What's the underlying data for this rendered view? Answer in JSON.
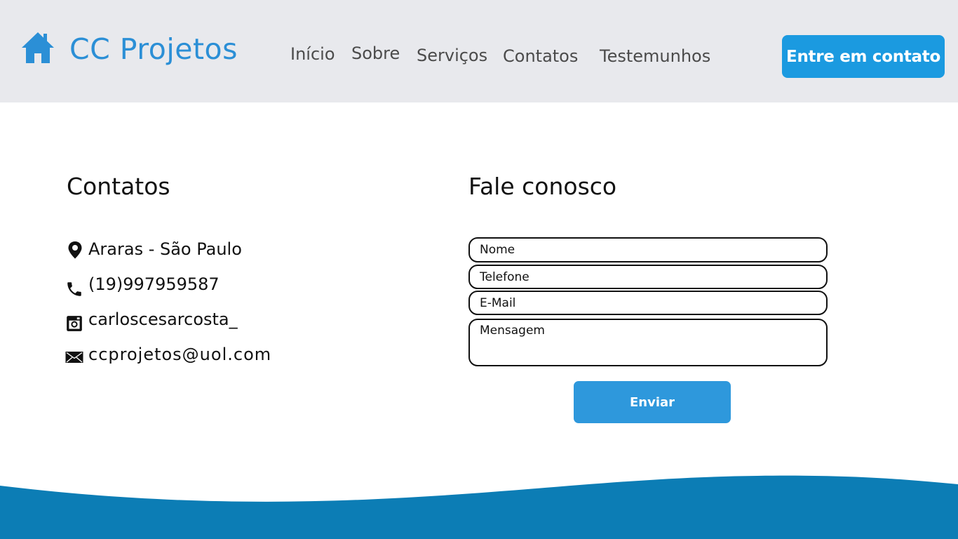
{
  "brand": {
    "name": "CC Projetos",
    "icon": "home-icon",
    "color": "#2b8fd6"
  },
  "nav": {
    "items": [
      {
        "label": "Início"
      },
      {
        "label": "Sobre"
      },
      {
        "label": "Serviços"
      },
      {
        "label": "Contatos"
      },
      {
        "label": "Testemunhos"
      }
    ],
    "cta_label": "Entre em contato"
  },
  "contacts": {
    "title": "Contatos",
    "items": [
      {
        "icon": "location-pin-icon",
        "text": "Araras - São Paulo"
      },
      {
        "icon": "phone-icon",
        "text": "(19)997959587"
      },
      {
        "icon": "instagram-icon",
        "text": "carloscesarcosta_"
      },
      {
        "icon": "envelope-icon",
        "text": "ccprojetos@uol.com"
      }
    ]
  },
  "form": {
    "title": "Fale conosco",
    "fields": {
      "name_placeholder": "Nome",
      "phone_placeholder": "Telefone",
      "email_placeholder": "E-Mail",
      "message_placeholder": "Mensagem"
    },
    "submit_label": "Enviar"
  },
  "colors": {
    "header_bg": "#e8e9ed",
    "accent": "#1b9ae0",
    "button": "#2e98dc",
    "footer_wave": "#0c7db5"
  }
}
